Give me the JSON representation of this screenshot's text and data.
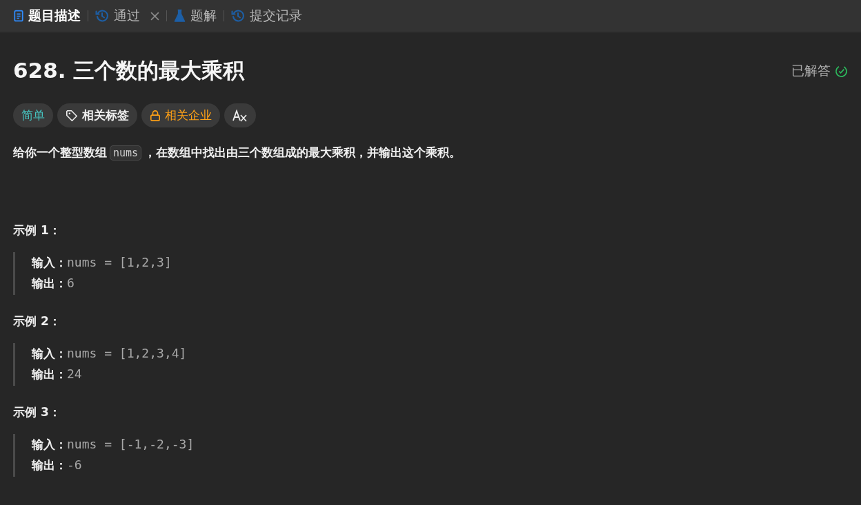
{
  "tabs": [
    {
      "label": "题目描述",
      "kind": "description",
      "selected": true
    },
    {
      "label": "通过",
      "kind": "result",
      "selected": false,
      "closable": true
    },
    {
      "label": "题解",
      "kind": "solutions",
      "selected": false
    },
    {
      "label": "提交记录",
      "kind": "submissions",
      "selected": false
    }
  ],
  "problem": {
    "title": "628. 三个数的最大乘积",
    "status": "已解答"
  },
  "tags": [
    {
      "label": "简单",
      "kind": "difficulty"
    },
    {
      "label": "相关标签",
      "kind": "topics"
    },
    {
      "label": "相关企业",
      "kind": "companies"
    },
    {
      "kind": "translate"
    }
  ],
  "description": {
    "before": "给你一个整型数组",
    "code": "nums",
    "after": "，在数组中找出由三个数组成的最大乘积，并输出这个乘积。"
  },
  "examples": [
    {
      "heading": "示例 1：",
      "input_label": "输入：",
      "input": "nums = [1,2,3]",
      "output_label": "输出：",
      "output": "6"
    },
    {
      "heading": "示例 2：",
      "input_label": "输入：",
      "input": "nums = [1,2,3,4]",
      "output_label": "输出：",
      "output": "24"
    },
    {
      "heading": "示例 3：",
      "input_label": "输入：",
      "input": "nums = [-1,-2,-3]",
      "output_label": "输出：",
      "output": "-6"
    }
  ]
}
